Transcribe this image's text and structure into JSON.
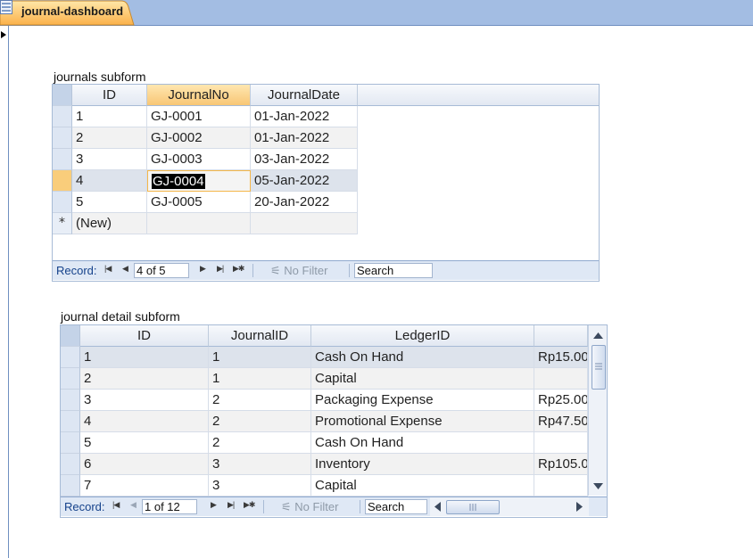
{
  "tab": {
    "label": "journal-dashboard"
  },
  "journals": {
    "label": "journals subform",
    "columns": [
      "ID",
      "JournalNo",
      "JournalDate"
    ],
    "rows": [
      [
        "1",
        "GJ-0001",
        "01-Jan-2022"
      ],
      [
        "2",
        "GJ-0002",
        "01-Jan-2022"
      ],
      [
        "3",
        "GJ-0003",
        "03-Jan-2022"
      ],
      [
        "4",
        "GJ-0004",
        "05-Jan-2022"
      ],
      [
        "5",
        "GJ-0005",
        "20-Jan-2022"
      ]
    ],
    "new_row": "(New)",
    "new_row_marker": "*",
    "nav": {
      "record_label": "Record:",
      "position": "4 of 5",
      "filter": "No Filter",
      "search": "Search"
    }
  },
  "details": {
    "label": "journal  detail subform",
    "columns": [
      "ID",
      "JournalID",
      "LedgerID",
      ""
    ],
    "rows": [
      [
        "1",
        "1",
        "Cash On Hand",
        "Rp15.00"
      ],
      [
        "2",
        "1",
        "Capital",
        ""
      ],
      [
        "3",
        "2",
        "Packaging Expense",
        "Rp25.00"
      ],
      [
        "4",
        "2",
        "Promotional Expense",
        "Rp47.50"
      ],
      [
        "5",
        "2",
        "Cash On Hand",
        ""
      ],
      [
        "6",
        "3",
        "Inventory",
        "Rp105.0"
      ],
      [
        "7",
        "3",
        "Capital",
        ""
      ]
    ],
    "nav": {
      "record_label": "Record:",
      "position": "1 of 12",
      "filter": "No Filter",
      "search": "Search"
    }
  },
  "colors": {
    "tab_active": "#fbb14a",
    "tab_strip": "#a3bde3",
    "header_active": "#f8c675",
    "focus_border": "#f5b74a"
  }
}
